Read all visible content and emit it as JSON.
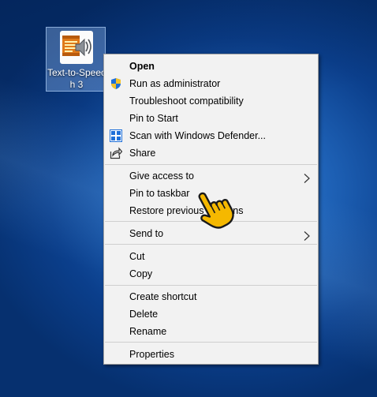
{
  "desktop": {
    "icon_label": "Text-to-Speech 3"
  },
  "menu": {
    "items": [
      {
        "label": "Open"
      },
      {
        "label": "Run as administrator"
      },
      {
        "label": "Troubleshoot compatibility"
      },
      {
        "label": "Pin to Start"
      },
      {
        "label": "Scan with Windows Defender..."
      },
      {
        "label": "Share"
      },
      {
        "label": "Give access to"
      },
      {
        "label": "Pin to taskbar"
      },
      {
        "label": "Restore previous versions"
      },
      {
        "label": "Send to"
      },
      {
        "label": "Cut"
      },
      {
        "label": "Copy"
      },
      {
        "label": "Create shortcut"
      },
      {
        "label": "Delete"
      },
      {
        "label": "Rename"
      },
      {
        "label": "Properties"
      }
    ]
  },
  "colors": {
    "menu_bg": "#f2f2f2",
    "cursor": "#f5b800",
    "desktop_blue": "#1f63b8"
  },
  "icons": {
    "app": "speaker-scroll-icon",
    "uac": "uac-shield-icon",
    "defender": "defender-icon",
    "share": "share-icon",
    "submenu": "chevron-right-icon",
    "cursor": "hand-pointer-icon"
  }
}
